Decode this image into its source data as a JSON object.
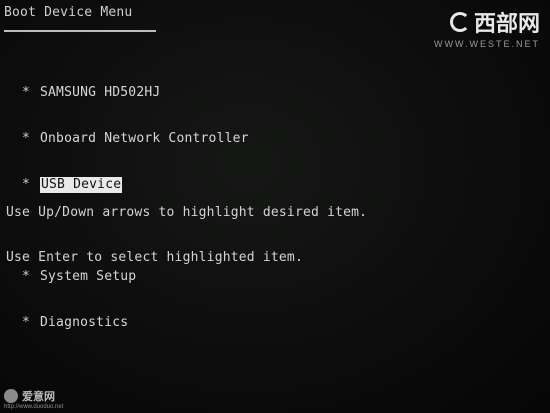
{
  "header": {
    "title": "Boot Device Menu"
  },
  "menu": {
    "items": [
      {
        "label": "SAMSUNG HD502HJ",
        "selected": false
      },
      {
        "label": "Onboard Network Controller",
        "selected": false
      },
      {
        "label": "USB Device",
        "selected": true
      }
    ],
    "extra_items": [
      {
        "label": "System Setup"
      },
      {
        "label": "Diagnostics"
      }
    ],
    "bullet": "*"
  },
  "help": {
    "line1": "Use Up/Down arrows to highlight desired item.",
    "line2": "Use Enter to select highlighted item."
  },
  "watermark": {
    "brand": "西部网",
    "url": "WWW.WESTE.NET"
  },
  "bottom_mark": {
    "brand": "爱意网",
    "url": "http://www.duoduo.net"
  },
  "colors": {
    "background": "#0b0c0b",
    "text": "#d7d7d7",
    "highlight_bg": "#e9e9e9",
    "highlight_text": "#111111"
  }
}
